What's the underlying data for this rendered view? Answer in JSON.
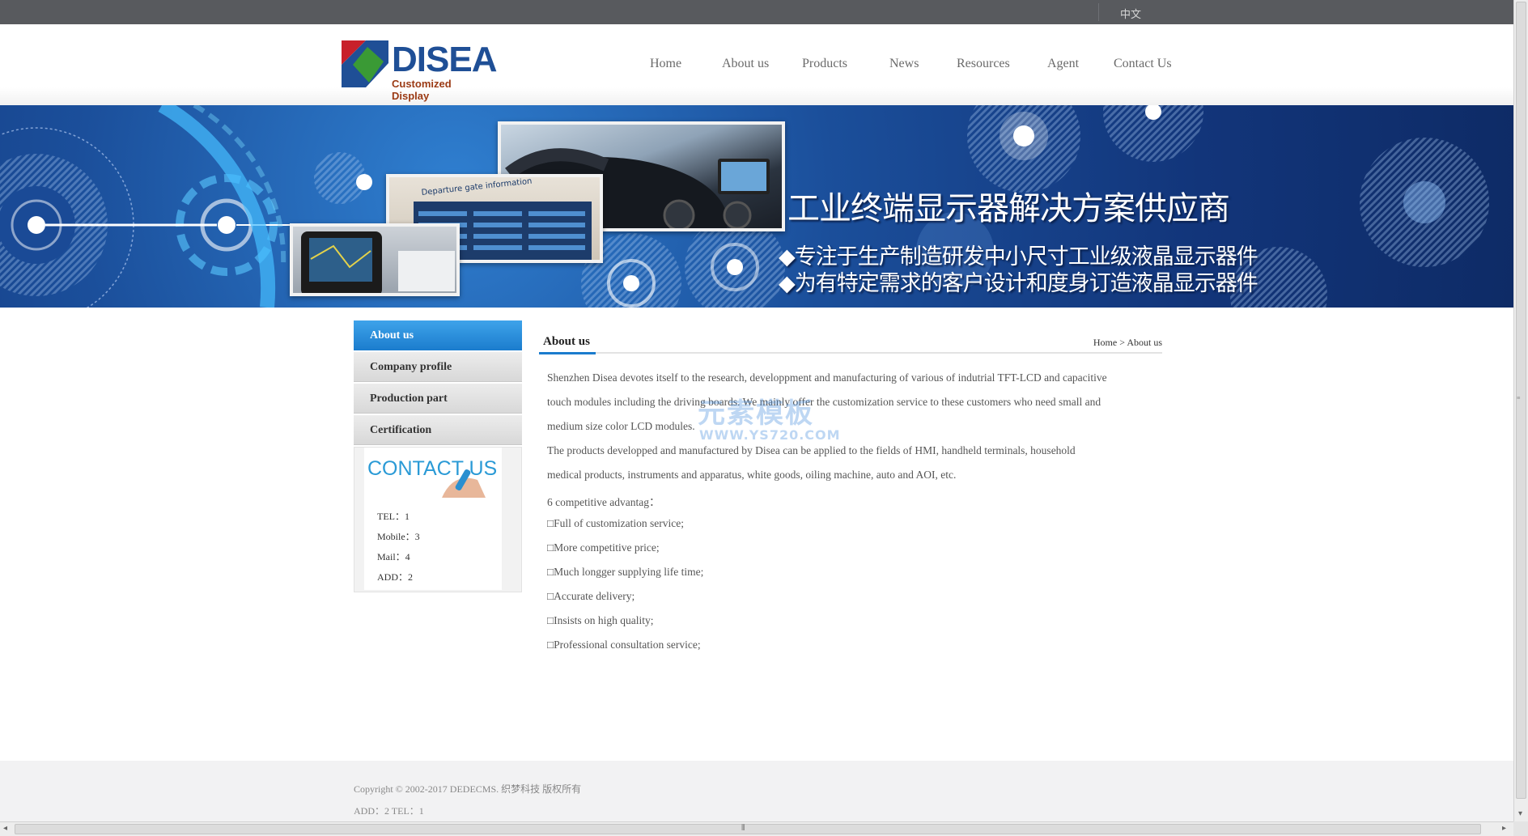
{
  "topbar": {
    "language": "中文"
  },
  "header": {
    "logo_text": "DISEA",
    "logo_sub": "Customized Display",
    "nav": [
      {
        "label": "Home"
      },
      {
        "label": "About us"
      },
      {
        "label": "Products"
      },
      {
        "label": "News"
      },
      {
        "label": "Resources"
      },
      {
        "label": "Agent"
      },
      {
        "label": "Contact Us"
      }
    ]
  },
  "banner": {
    "headline": "工业终端显示器解决方案供应商",
    "line1": "◆专注于生产制造研发中小尺寸工业级液晶显示器件",
    "line2": "◆为有特定需求的客户设计和度身订造液晶显示器件",
    "photo_caption": "Departure gate information"
  },
  "sidebar": {
    "items": [
      {
        "label": "About us"
      },
      {
        "label": "Company profile"
      },
      {
        "label": "Production part"
      },
      {
        "label": "Certification"
      }
    ],
    "contact_title": "CONTACT US",
    "contact": {
      "tel": "TEL：1",
      "mobile": "Mobile：3",
      "mail": "Mail：4",
      "add": "ADD：2"
    }
  },
  "main": {
    "title": "About us",
    "breadcrumb": {
      "home": "Home",
      "sep": " > ",
      "current": "About us"
    },
    "paragraphs": [
      " Shenzhen Disea devotes itself to the research, developpment and manufacturing of various of indutrial TFT-LCD and capacitive",
      "touch modules including the driving boards. We mainly offer the customization service to these customers who need small and",
      "medium size color LCD modules.",
      "       The products developped and manufactured by Disea can be applied to the fields of HMI, handheld terminals, household",
      "medical products, instruments and apparatus, white goods, oiling machine, auto and AOI, etc.",
      "       6 competitive advantag：",
      "       □Full of customization service;",
      "       □More competitive price;",
      "       □Much longger supplying life time;",
      "       □Accurate delivery;",
      "       □Insists on high quality;",
      "       □Professional consultation service;"
    ]
  },
  "watermark": {
    "text": "元素模板",
    "url": "WWW.YS720.COM"
  },
  "footer": {
    "copyright": "Copyright © 2002-2017 DEDECMS. 织梦科技 版权所有",
    "address": "ADD：2 TEL：1"
  },
  "colors": {
    "accent_blue": "#1b7ccd",
    "topbar": "#585a5e",
    "logo_blue": "#1f4f96",
    "logo_red": "#c8202a",
    "logo_green": "#3a9a35"
  }
}
